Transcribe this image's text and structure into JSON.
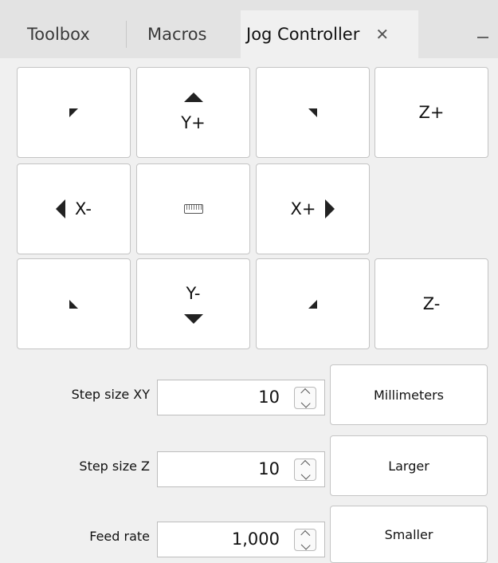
{
  "tabs": [
    {
      "label": "Toolbox",
      "active": false
    },
    {
      "label": "Macros",
      "active": false
    },
    {
      "label": "Jog Controller",
      "active": true,
      "close": "✕"
    }
  ],
  "jog": {
    "y_plus": "Y+",
    "y_minus": "Y-",
    "x_minus": "X-",
    "x_plus": "X+",
    "z_plus": "Z+",
    "z_minus": "Z-",
    "keyboard_icon": "keyboard-icon"
  },
  "settings": {
    "step_xy": {
      "label": "Step size XY",
      "value": "10"
    },
    "step_z": {
      "label": "Step size Z",
      "value": "10"
    },
    "feed_rate": {
      "label": "Feed rate",
      "value": "1,000"
    }
  },
  "buttons": {
    "units": "Millimeters",
    "larger": "Larger",
    "smaller": "Smaller"
  }
}
